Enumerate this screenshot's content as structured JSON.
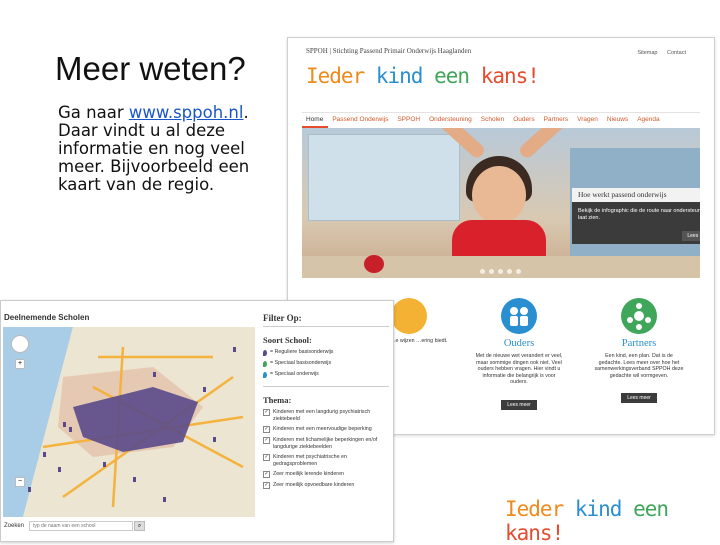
{
  "slide": {
    "title": "Meer weten?",
    "intro": "Ga naar ",
    "link": "www.sppoh.nl",
    "after_link": ".",
    "body": "Daar vindt u al deze informatie en nog veel meer. Bijvoorbeeld een kaart van de regio."
  },
  "website": {
    "header": "SPPOH | Stichting Passend Primair Onderwijs Haaglanden",
    "top_links": [
      "Sitemap",
      "Contact"
    ],
    "logo": {
      "w1": "Ieder",
      "w2": "kind",
      "w3": "een",
      "w4": "kans!"
    },
    "nav": [
      "Home",
      "Passend Onderwijs",
      "SPPOH",
      "Ondersteuning",
      "Scholen",
      "Ouders",
      "Partners",
      "Vragen",
      "Nieuws",
      "Agenda"
    ],
    "info_box": {
      "title": "Hoe werkt passend onderwijs",
      "text": "Bekijk de infographic die de route naar ondersteuning laat zien.",
      "button": "Lees meer"
    },
    "columns": [
      {
        "title": "",
        "text": "…chten  …e wijzen …ering biedt.",
        "button": ""
      },
      {
        "title": "Ouders",
        "text": "Met de nieuwe wet verandert er veel, maar sommige dingen ook niet. Veel ouders hebben vragen. Hier vindt u informatie die belangrijk is voor ouders.",
        "button": "Lees meer"
      },
      {
        "title": "Partners",
        "text": "Een kind, een plan. Dat is de gedachte. Lees meer over hoe het samenwerkingsverband SPPOH deze gedachte wil vormgeven.",
        "button": "Lees meer"
      }
    ]
  },
  "map": {
    "title": "Deelnemende Scholen",
    "search_label": "Zoeken",
    "search_placeholder": "typ de naam van een school",
    "filter_title": "Filter Op:",
    "soort_title": "Soort School:",
    "soort": [
      "= Reguliere basisonderwijs",
      "= Speciaal basisonderwijs",
      "= Speciaal onderwijs"
    ],
    "thema_title": "Thema:",
    "thema": [
      "Kinderen met een langdurig psychiatrisch ziektebeeld",
      "Kinderen met een meervoudige beperking",
      "Kinderen met lichamelijke beperkingen en/of langdurige ziektebeelden",
      "Kinderen met psychiatrische en gedragsproblemen",
      "Zeer moeilijk lerende kinderen",
      "Zeer moeilijk opvoedbare kinderen"
    ],
    "zoom_plus": "+",
    "zoom_minus": "−"
  },
  "bottom_logo": {
    "w1": "Ieder",
    "w2": "kind",
    "w3": "een",
    "w4": "kans!"
  },
  "colors": {
    "logo_orange": "#ef8a1d",
    "logo_blue": "#2a8fd0",
    "logo_green": "#3fa65a",
    "logo_red": "#e54c2f",
    "pin_purple": "#5a4a8a"
  }
}
